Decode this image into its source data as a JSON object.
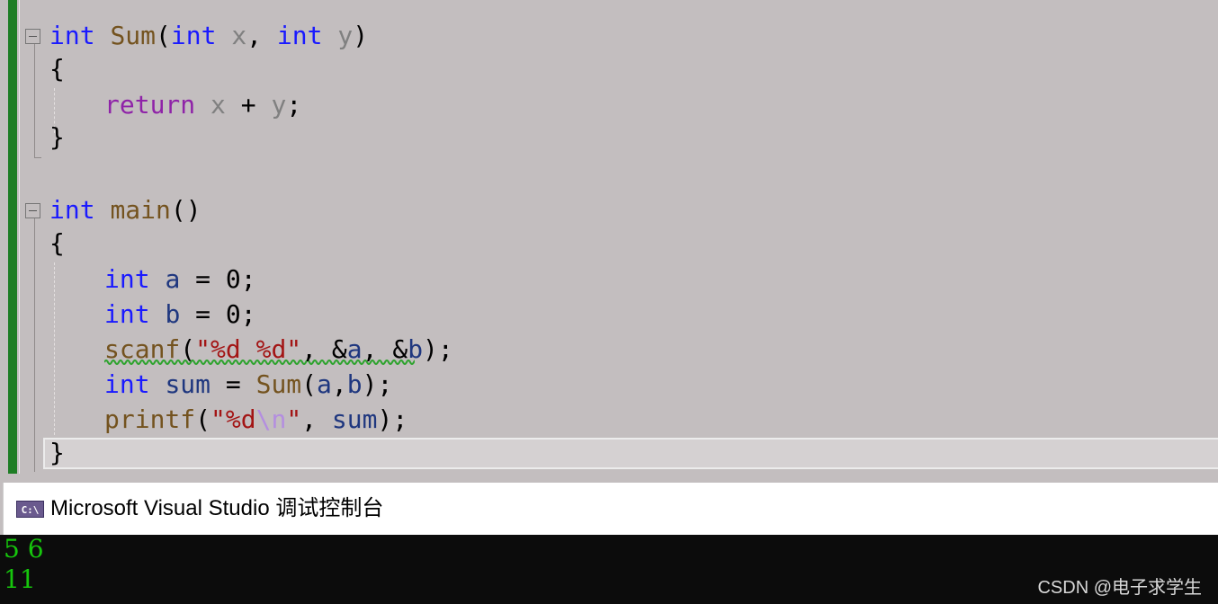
{
  "editor": {
    "lines": [
      [
        "int",
        "Sum",
        "(",
        "int",
        "x",
        ",",
        "int",
        "y",
        ")"
      ],
      [
        "{"
      ],
      [
        "return",
        "x",
        "+",
        "y",
        ";"
      ],
      [
        "}"
      ],
      [
        "int",
        "main",
        "()"
      ],
      [
        "{"
      ],
      [
        "int",
        "a",
        "=",
        "0",
        ";"
      ],
      [
        "int",
        "b",
        "=",
        "0",
        ";"
      ],
      [
        "scanf",
        "(",
        "\"%d %d\"",
        ",",
        "&",
        "a",
        ",",
        "&",
        "b",
        ");"
      ],
      [
        "int",
        "sum",
        "=",
        "Sum",
        "(",
        "a",
        ",",
        "b",
        ");"
      ],
      [
        "printf",
        "(",
        "\"%d",
        "\\n",
        "\"",
        ",",
        "sum",
        ");"
      ],
      [
        "}"
      ]
    ]
  },
  "console": {
    "icon_text": "C:\\",
    "title": "Microsoft Visual Studio 调试控制台",
    "output": [
      "5 6",
      "11"
    ]
  },
  "watermark": "CSDN @电子求学生",
  "colors": {
    "editor_bg": "#c3bebf",
    "keyword": "#1a1aff",
    "return_keyword": "#8f23a8",
    "function": "#74531f",
    "parameter": "#808080",
    "local": "#1f377f",
    "string": "#a31515",
    "escape": "#b48ee0",
    "change_bar": "#1e7d25",
    "console_text": "#16c60c",
    "console_bg": "#0c0c0c"
  }
}
